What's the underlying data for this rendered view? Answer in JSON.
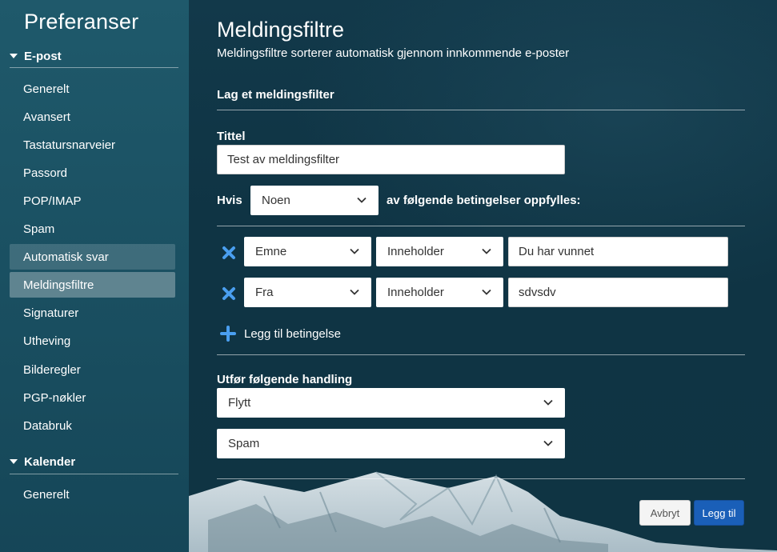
{
  "sidebar": {
    "title": "Preferanser",
    "sections": [
      {
        "label": "E-post",
        "items": [
          {
            "label": "Generelt"
          },
          {
            "label": "Avansert"
          },
          {
            "label": "Tastatursnarveier"
          },
          {
            "label": "Passord"
          },
          {
            "label": "POP/IMAP"
          },
          {
            "label": "Spam"
          },
          {
            "label": "Automatisk svar"
          },
          {
            "label": "Meldingsfiltre"
          },
          {
            "label": "Signaturer"
          },
          {
            "label": "Utheving"
          },
          {
            "label": "Bilderegler"
          },
          {
            "label": "PGP-nøkler"
          },
          {
            "label": "Databruk"
          }
        ]
      },
      {
        "label": "Kalender",
        "items": [
          {
            "label": "Generelt"
          }
        ]
      }
    ]
  },
  "main": {
    "title": "Meldingsfiltre",
    "subtitle": "Meldingsfiltre sorterer automatisk gjennom innkommende e-poster",
    "section_title": "Lag et meldingsfilter",
    "title_label": "Tittel",
    "title_value": "Test av meldingsfilter",
    "if_label": "Hvis",
    "match_select": "Noen",
    "match_suffix": "av følgende betingelser oppfylles:",
    "conditions": [
      {
        "field": "Emne",
        "operator": "Inneholder",
        "value": "Du har vunnet"
      },
      {
        "field": "Fra",
        "operator": "Inneholder",
        "value": "sdvsdv"
      }
    ],
    "add_condition_label": "Legg til betingelse",
    "action_label": "Utfør følgende handling",
    "action_select": "Flytt",
    "target_select": "Spam",
    "cancel_label": "Avbryt",
    "submit_label": "Legg til"
  },
  "colors": {
    "accent_blue": "#4a9ff0",
    "submit_button": "#1a5fb8",
    "background": "#0f3442"
  }
}
